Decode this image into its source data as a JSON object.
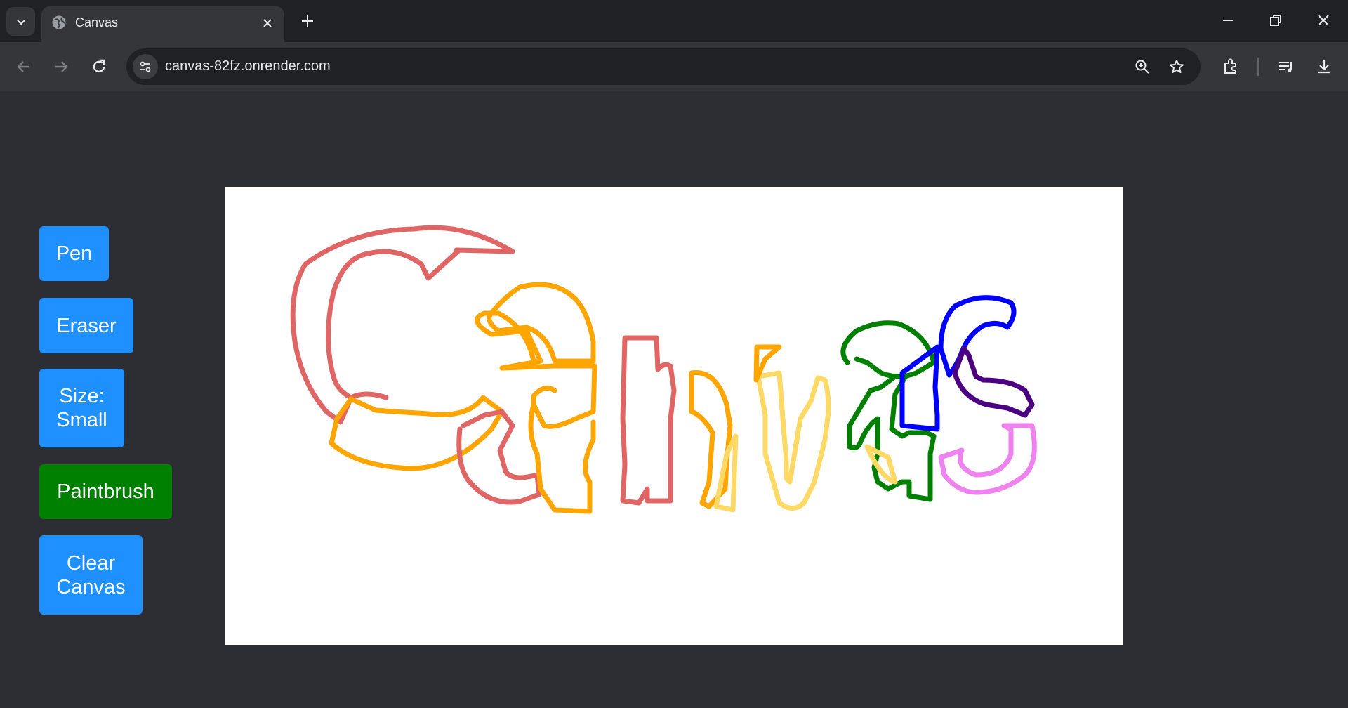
{
  "browser": {
    "tab_title": "Canvas",
    "url": "canvas-82fz.onrender.com"
  },
  "sidebar": {
    "pen_label": "Pen",
    "eraser_label": "Eraser",
    "size_label": "Size: Small",
    "paintbrush_label": "Paintbrush",
    "clear_label": "Clear Canvas",
    "active_tool": "Paintbrush"
  },
  "colors": {
    "button_blue": "#1e90ff",
    "button_active_green": "#008000",
    "page_background": "#2d2e33",
    "canvas_background": "#ffffff"
  },
  "drawing": {
    "description_strokes": [
      "#e06666",
      "#ffa500",
      "#ffd966",
      "#008000",
      "#0000ff",
      "#4b0082",
      "#ee82ee"
    ]
  }
}
